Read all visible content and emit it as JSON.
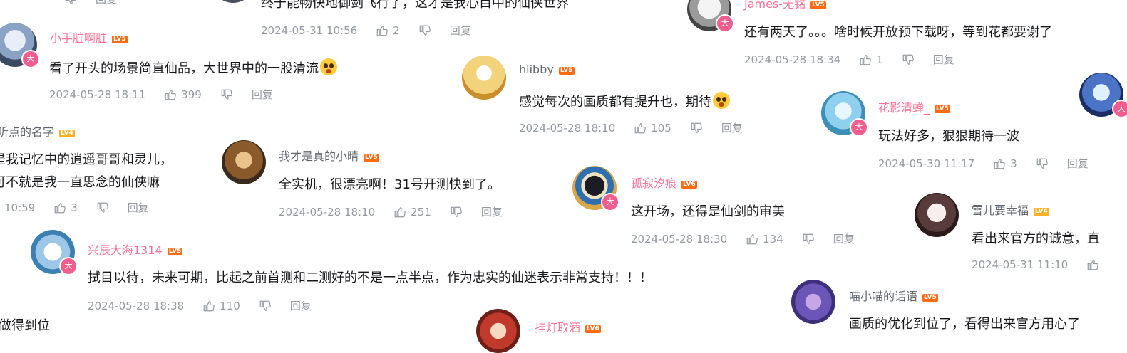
{
  "reply_label": "回复",
  "comments": [
    {
      "user": "小手脏啊脏",
      "level": "LV5",
      "text": "看了开头的场景简直仙品，大世界中的一股清流",
      "time": "2024-05-28 18:11",
      "likes": "399",
      "vip": "大"
    },
    {
      "user": "hlibby",
      "level": "LV5",
      "text": "感觉每次的画质都有提升也，期待",
      "time": "2024-05-28 18:10",
      "likes": "105"
    },
    {
      "user": "James-无铭",
      "level": "LV5",
      "text": "还有两天了。。。啥时候开放预下载呀，等到花都要谢了",
      "time": "2024-05-28 18:34",
      "likes": "1",
      "vip": "大"
    },
    {
      "user": "",
      "level": "",
      "text": "终于能畅快地御剑飞行了，这才是我心目中的仙侠世界",
      "time": "2024-05-31 10:56",
      "likes": "2"
    },
    {
      "user": "花影清蝉_",
      "level": "LV5",
      "text": "玩法好多，狠狠期待一波",
      "time": "2024-05-30 11:17",
      "likes": "3",
      "vip": "大"
    },
    {
      "user": "听点的名字",
      "level": "LV4",
      "text1": "是我记忆中的逍遥哥哥和灵儿，",
      "text2": "可不就是我一直思念的仙侠嘛",
      "time": "10:59",
      "likes": "3"
    },
    {
      "user": "我才是真的小晴",
      "level": "LV5",
      "text": "全实机，很漂亮啊！31号开测快到了。",
      "time": "2024-05-28 18:10",
      "likes": "251"
    },
    {
      "user": "孤寂汐痕",
      "level": "LV6",
      "text": "这开场，还得是仙剑的审美",
      "time": "2024-05-28 18:30",
      "likes": "134",
      "vip": "大"
    },
    {
      "user": "雪儿要幸福",
      "level": "LV4",
      "text": "看出来官方的诚意，直",
      "time": "2024-05-31 11:10"
    },
    {
      "user": "兴辰大海1314",
      "level": "LV5",
      "text": "拭目以待，未来可期，比起之前首测和二测好的不是一点半点，作为忠实的仙迷表示非常支持！！！",
      "time": "2024-05-28 18:38",
      "likes": "110",
      "vip": "大"
    },
    {
      "user": "喵小喵的话语",
      "level": "LV5",
      "text": "画质的优化到位了，看得出来官方用心了",
      "vip": ""
    },
    {
      "user": "挂灯取酒",
      "level": "LV6"
    },
    {
      "text": "做得到位"
    }
  ]
}
